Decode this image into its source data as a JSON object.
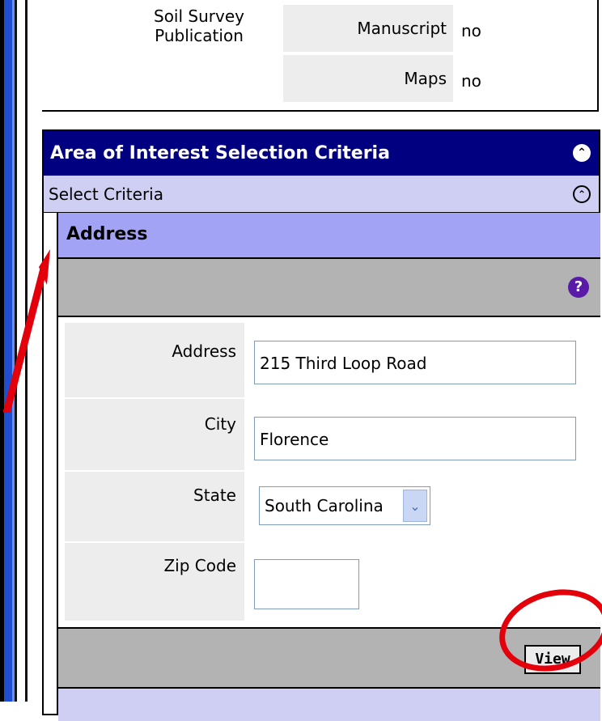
{
  "soil_survey": {
    "label": "Soil Survey Publication",
    "rows": [
      {
        "label": "Manuscript",
        "value": "no"
      },
      {
        "label": "Maps",
        "value": "no"
      }
    ]
  },
  "area_of_interest": {
    "title": "Area of Interest Selection Criteria",
    "subheader": "Select Criteria",
    "section_title": "Address"
  },
  "form": {
    "address": {
      "label": "Address",
      "value": "215 Third Loop Road"
    },
    "city": {
      "label": "City",
      "value": "Florence"
    },
    "state": {
      "label": "State",
      "value": "South Carolina"
    },
    "zip": {
      "label": "Zip Code",
      "value": ""
    },
    "view_button": "View"
  },
  "icons": {
    "collapse": "double-chevron-up-icon",
    "help": "question-icon",
    "dropdown": "chevron-down-icon"
  },
  "colors": {
    "navy_header": "#000080",
    "lilac": "#cfcff4",
    "annotation_red": "#e3000b"
  }
}
